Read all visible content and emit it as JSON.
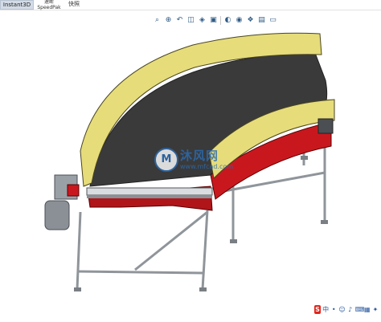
{
  "ribbon": {
    "instant3d": "Instant3D",
    "speedpak_top": "速断",
    "speedpak": "SpeedPak",
    "fast_snapshot": "快照"
  },
  "view_toolbar": {
    "icons": [
      "zoom-fit-icon",
      "zoom-area-icon",
      "previous-view-icon",
      "section-view-icon",
      "view-orientation-icon",
      "display-style-icon",
      "hide-show-icon",
      "edit-appearance-icon",
      "scene-icon",
      "view-settings-icon",
      "display-icon"
    ]
  },
  "watermark": {
    "logo": "M",
    "brand": "沐风网",
    "url": "www.mfcad.com"
  },
  "ime_bar": {
    "logo": "S",
    "items": [
      "中",
      "•",
      "☺",
      "♪",
      "⌨",
      "▦",
      "✦"
    ]
  },
  "colors": {
    "belt": "#3a3a3a",
    "rail": "#e6dc7a",
    "frame_red": "#c8181e",
    "legs": "#a9aeb3"
  }
}
